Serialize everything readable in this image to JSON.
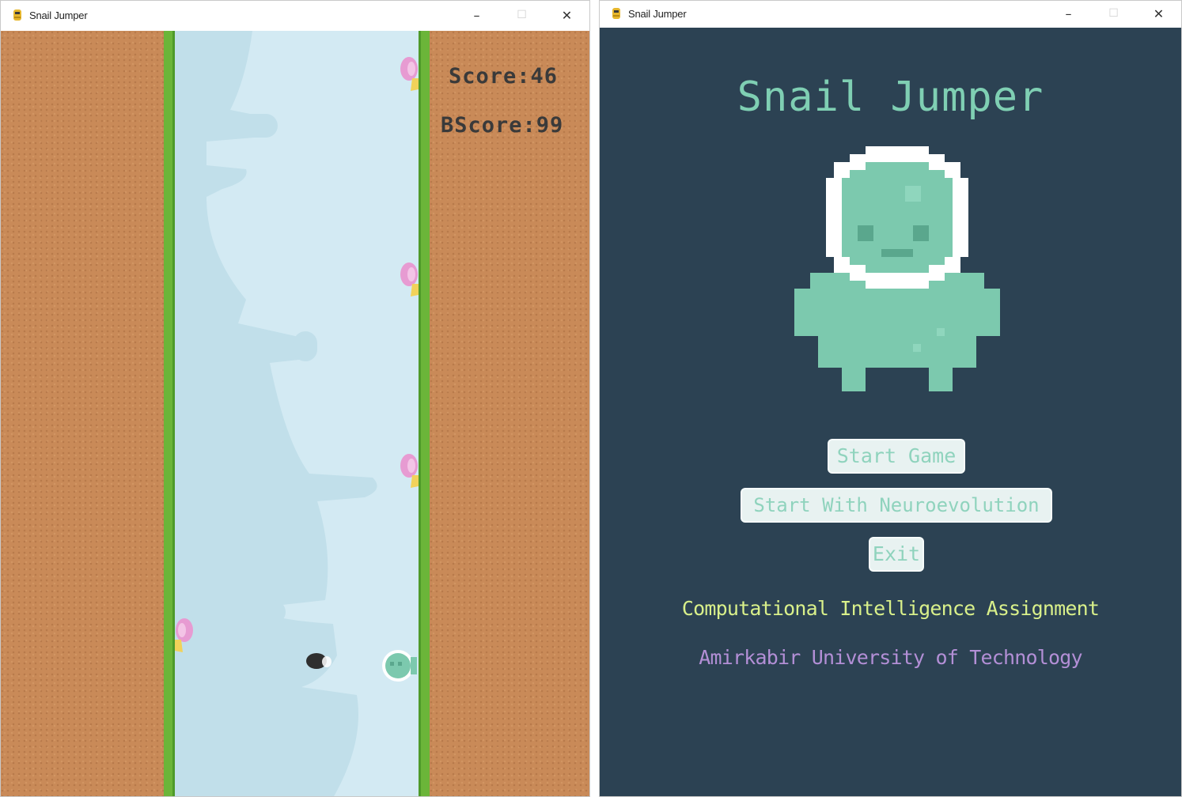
{
  "windows": {
    "game": {
      "title": "Snail Jumper",
      "score_label": "Score:46",
      "best_score_label": "BScore:99",
      "colors": {
        "dirt": "#c98a58",
        "grass": "#6bb539",
        "sky": "#d3eaf3",
        "text": "#3a3a3a"
      },
      "icons": [
        "pygame-icon",
        "minimize-icon",
        "maximize-icon",
        "close-icon",
        "snail-icon",
        "player-icon",
        "fly-icon"
      ]
    },
    "menu": {
      "title": "Snail Jumper",
      "heading": "Snail Jumper",
      "buttons": {
        "start_game": "Start Game",
        "start_neuro": "Start With Neuroevolution",
        "exit": "Exit"
      },
      "caption_course": "Computational Intelligence Assignment",
      "caption_university": "Amirkabir University of Technology",
      "colors": {
        "background": "#2c4253",
        "accent": "#7fcfb3",
        "course": "#d9f08a",
        "university": "#b38fd6"
      },
      "icons": [
        "pygame-icon",
        "minimize-icon",
        "maximize-icon",
        "close-icon",
        "alien-astronaut-icon"
      ]
    }
  },
  "window_controls": {
    "minimize": "–",
    "maximize": "☐",
    "close": "✕"
  }
}
